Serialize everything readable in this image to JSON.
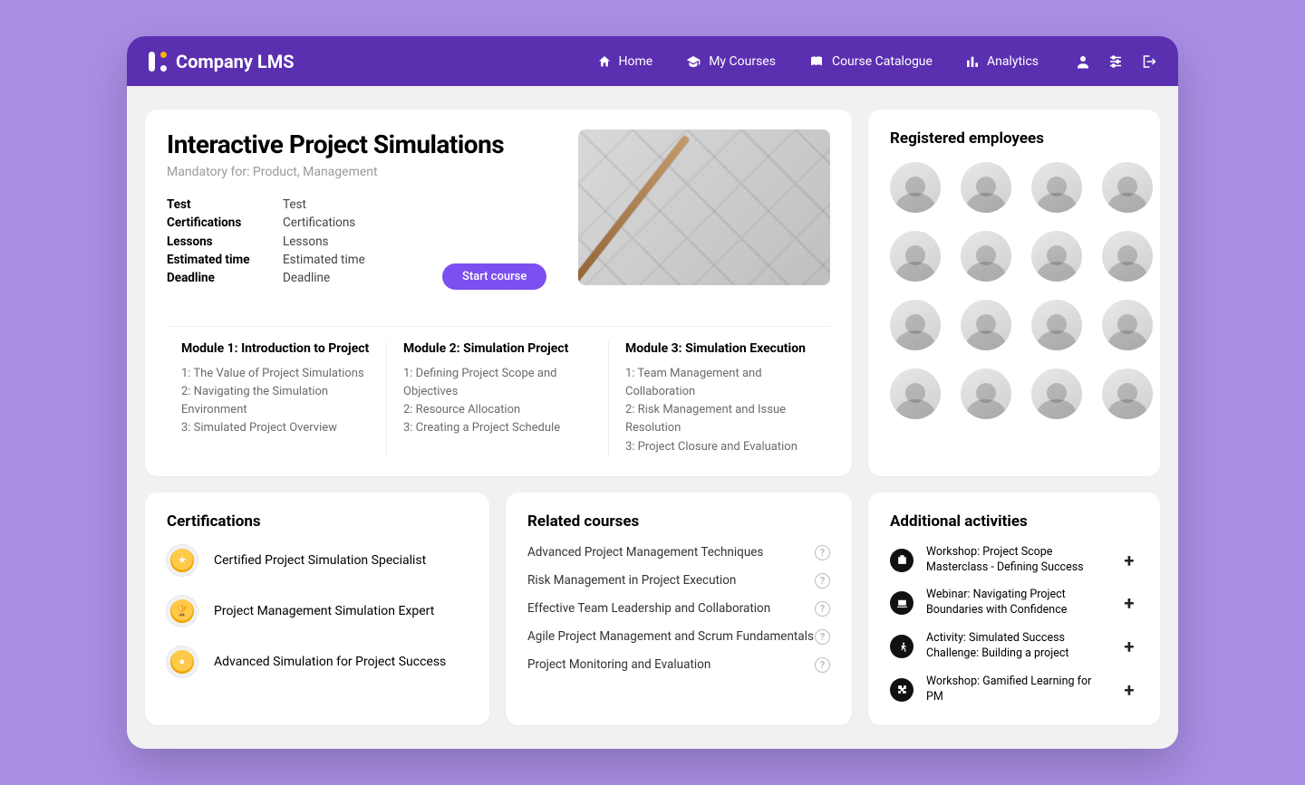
{
  "brand": "Company LMS",
  "nav": {
    "home": "Home",
    "my_courses": "My Courses",
    "catalogue": "Course Catalogue",
    "analytics": "Analytics"
  },
  "course": {
    "title": "Interactive Project Simulations",
    "subtitle": "Mandatory for: Product, Management",
    "meta": [
      {
        "k": "Test",
        "v": "Test"
      },
      {
        "k": "Certifications",
        "v": "Certifications"
      },
      {
        "k": "Lessons",
        "v": "Lessons"
      },
      {
        "k": "Estimated time",
        "v": "Estimated time"
      },
      {
        "k": "Deadline",
        "v": "Deadline"
      }
    ],
    "start_label": "Start course"
  },
  "modules": [
    {
      "title": "Module 1: Introduction to Project",
      "items": [
        "1: The Value of Project Simulations",
        "2: Navigating the Simulation Environment",
        "3: Simulated Project Overview"
      ]
    },
    {
      "title": "Module 2: Simulation Project",
      "items": [
        "1: Defining Project Scope and Objectives",
        "2: Resource Allocation",
        "3: Creating a Project Schedule"
      ]
    },
    {
      "title": "Module 3: Simulation Execution",
      "items": [
        "1: Team Management and Collaboration",
        "2: Risk Management and Issue Resolution",
        "3: Project Closure and Evaluation"
      ]
    }
  ],
  "employees_title": "Registered employees",
  "certs_title": "Certifications",
  "certs": [
    "Certified Project Simulation Specialist",
    "Project Management Simulation Expert",
    "Advanced Simulation for Project Success"
  ],
  "related_title": "Related courses",
  "related": [
    "Advanced Project Management Techniques",
    "Risk Management in Project Execution",
    "Effective Team Leadership and Collaboration",
    "Agile Project Management and Scrum Fundamentals",
    "Project Monitoring and Evaluation"
  ],
  "activities_title": "Additional activities",
  "activities": [
    {
      "icon": "briefcase",
      "text": "Workshop: Project Scope Masterclass - Defining Success"
    },
    {
      "icon": "laptop",
      "text": "Webinar: Navigating Project Boundaries with Confidence"
    },
    {
      "icon": "run",
      "text": "Activity: Simulated Success Challenge: Building a project"
    },
    {
      "icon": "puzzle",
      "text": "Workshop: Gamified Learning for PM"
    }
  ]
}
